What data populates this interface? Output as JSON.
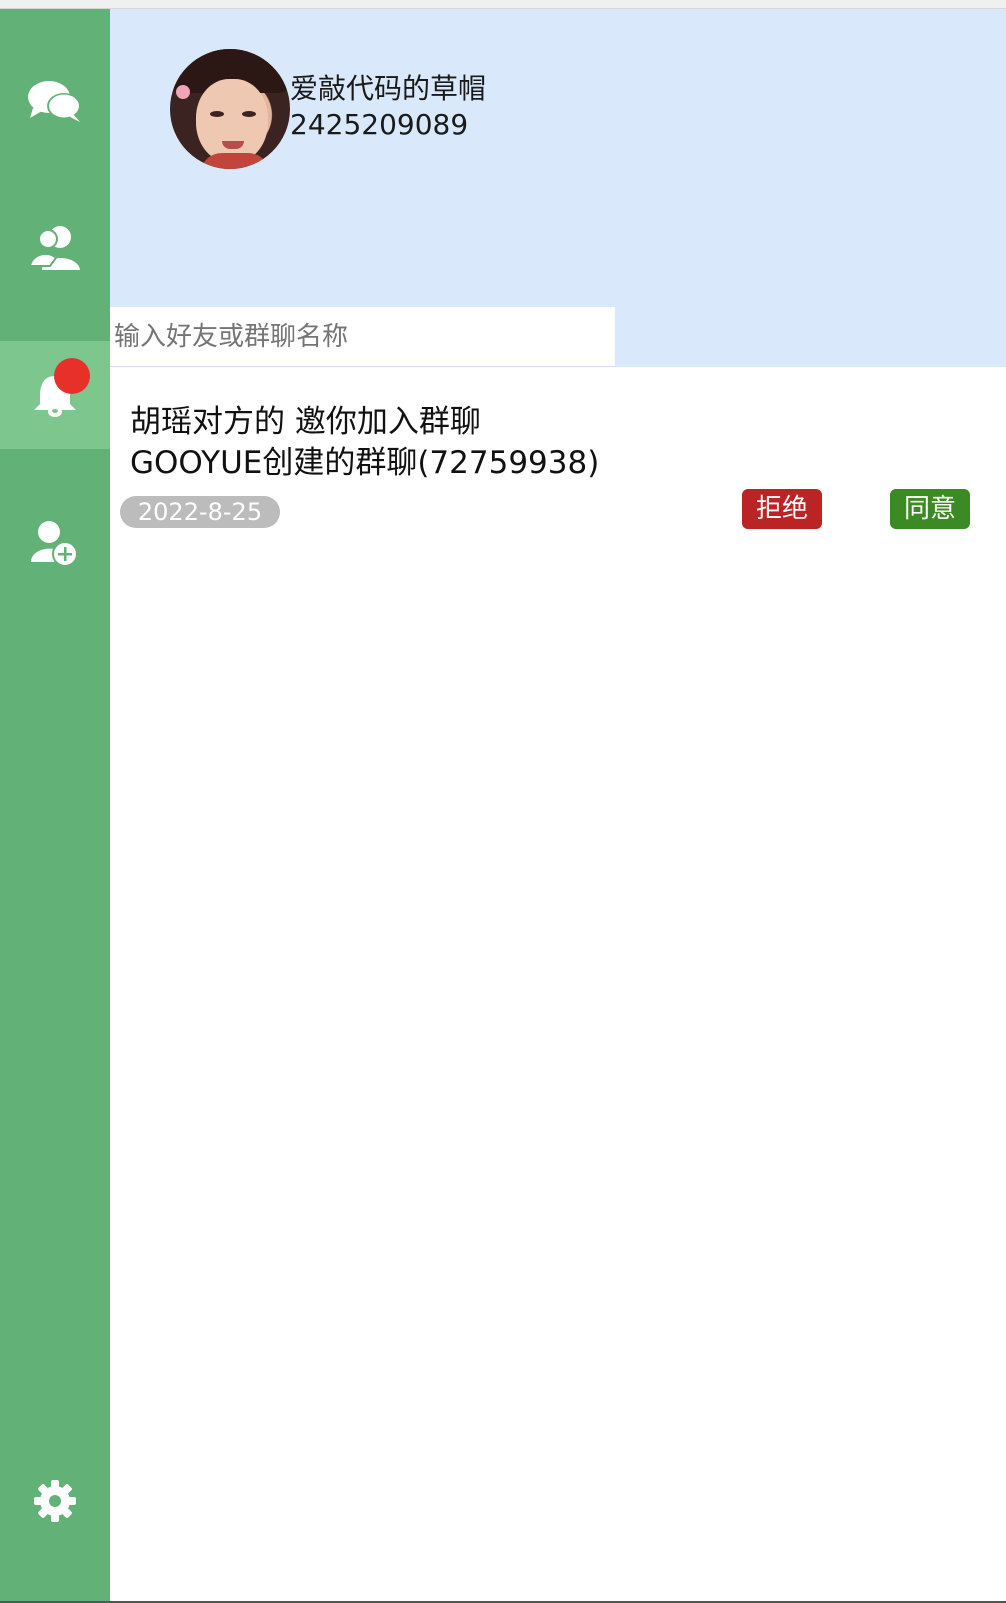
{
  "sidebar": {
    "items": [
      {
        "name": "chat",
        "icon": "chat-bubbles-icon"
      },
      {
        "name": "contacts",
        "icon": "contacts-icon"
      },
      {
        "name": "notifications",
        "icon": "bell-icon",
        "active": true,
        "badge": true
      },
      {
        "name": "add-friend",
        "icon": "add-user-icon"
      }
    ],
    "settings_icon": "gear-icon"
  },
  "profile": {
    "name": "爱敲代码的草帽",
    "id": "2425209089"
  },
  "search": {
    "placeholder": "输入好友或群聊名称",
    "value": ""
  },
  "notifications": [
    {
      "line1": "胡瑶对方的 邀你加入群聊",
      "line2": "GOOYUE创建的群聊(72759938)",
      "date": "2022-8-25",
      "reject_label": "拒绝",
      "accept_label": "同意"
    }
  ],
  "colors": {
    "sidebar": "#62b177",
    "sidebar_active": "#7dc78f",
    "header_bg": "#d9e9fb",
    "badge": "#e8302b",
    "reject": "#ba2424",
    "accept": "#3b8a23",
    "date_badge": "#bcbcbc"
  }
}
